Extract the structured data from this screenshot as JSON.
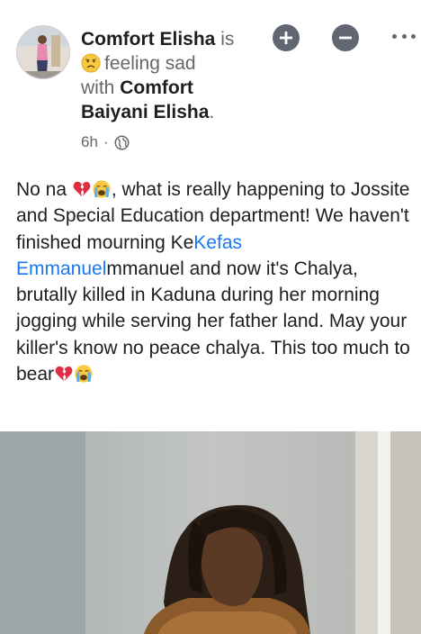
{
  "post": {
    "author": "Comfort Elisha",
    "connector_is": "is",
    "feeling": "feeling sad",
    "with_text": "with",
    "tagged": "Comfort Baiyani Elisha",
    "tagged_period": ".",
    "time": "6h",
    "separator": "·",
    "privacy_icon": "globe-icon",
    "text_parts": {
      "p1": "No na ",
      "p2": ", what is really happening to Jossite and Special Education department! We haven't finished mourning Ke",
      "mention": "Kefas Emmanuel",
      "p3": "mmanuel and now it's Chalya, brutally killed in Kaduna during her morning jogging while serving her father land. May your killer's know no peace chalya. This too much to bear"
    }
  },
  "icons": {
    "add": "plus-circle-icon",
    "remove": "minus-circle-icon",
    "more": "more-horizontal-icon",
    "feeling": "sad-face-emoji",
    "broken_heart": "broken-heart-emoji",
    "crying": "crying-face-emoji"
  },
  "colors": {
    "link": "#1877f2",
    "muted": "#65676b",
    "icon_gray": "#606770"
  }
}
